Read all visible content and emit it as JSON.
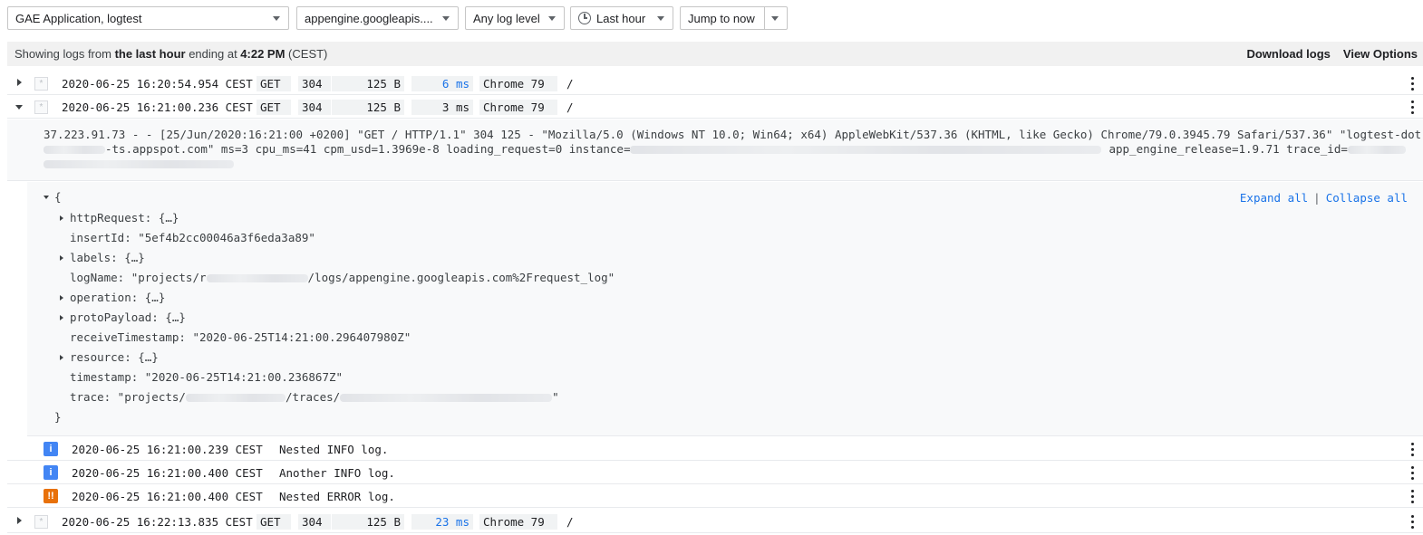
{
  "toolbar": {
    "resource": "GAE Application, logtest",
    "log_source": "appengine.googleapis....",
    "log_level": "Any log level",
    "time_range": "Last hour",
    "jump": "Jump to now"
  },
  "header": {
    "prefix": "Showing logs from ",
    "range": "the last hour",
    "middle": " ending at ",
    "time": "4:22 PM",
    "tz": " (CEST)",
    "download": "Download logs",
    "view_options": "View Options"
  },
  "entries": [
    {
      "timestamp": "2020-06-25 16:20:54.954 CEST",
      "method": "GET",
      "status": "304",
      "size": "125 B",
      "latency": "6 ms",
      "agent": "Chrome 79",
      "path": "/"
    },
    {
      "timestamp": "2020-06-25 16:21:00.236 CEST",
      "method": "GET",
      "status": "304",
      "size": "125 B",
      "latency": "3 ms",
      "agent": "Chrome 79",
      "path": "/"
    },
    {
      "timestamp": "2020-06-25 16:22:13.835 CEST",
      "method": "GET",
      "status": "304",
      "size": "125 B",
      "latency": "23 ms",
      "agent": "Chrome 79",
      "path": "/"
    }
  ],
  "raw": {
    "line1": "37.223.91.73 - - [25/Jun/2020:16:21:00 +0200] \"GET / HTTP/1.1\" 304 125 - \"Mozilla/5.0 (Windows NT 10.0; Win64; x64) AppleWebKit/537.36 (KHTML, like Gecko) Chrome/79.0.3945.79 Safari/537.36\" \"logtest-dot-",
    "line2a": "-ts.appspot.com\" ms=3 cpu_ms=41 cpm_usd=1.3969e-8 loading_request=0 instance=",
    "line2b": "app_engine_release=1.9.71 trace_id="
  },
  "json": {
    "open_brace": "{",
    "close_brace": "}",
    "expand_all": "Expand all",
    "separator": "|",
    "collapse_all": "Collapse all",
    "fields": {
      "httpRequest": "httpRequest: {…}",
      "insertId": "insertId: \"5ef4b2cc00046a3f6eda3a89\"",
      "labels": "labels: {…}",
      "logName_a": "logName: \"projects/r",
      "logName_b": "/logs/appengine.googleapis.com%2Frequest_log\"",
      "operation": "operation: {…}",
      "protoPayload": "protoPayload: {…}",
      "receiveTimestamp": "receiveTimestamp: \"2020-06-25T14:21:00.296407980Z\"",
      "resource": "resource: {…}",
      "timestamp": "timestamp: \"2020-06-25T14:21:00.236867Z\"",
      "trace_a": "trace: \"projects/",
      "trace_b": "/traces/",
      "trace_c": "\""
    }
  },
  "nested_logs": [
    {
      "severity": "info",
      "icon": "i",
      "timestamp": "2020-06-25 16:21:00.239 CEST",
      "message": "Nested INFO log."
    },
    {
      "severity": "info",
      "icon": "i",
      "timestamp": "2020-06-25 16:21:00.400 CEST",
      "message": "Another INFO log."
    },
    {
      "severity": "error",
      "icon": "!!",
      "timestamp": "2020-06-25 16:21:00.400 CEST",
      "message": "Nested ERROR log."
    }
  ],
  "colors": {
    "accent": "#1a73e8",
    "info": "#4285f4",
    "error": "#e8710a"
  }
}
